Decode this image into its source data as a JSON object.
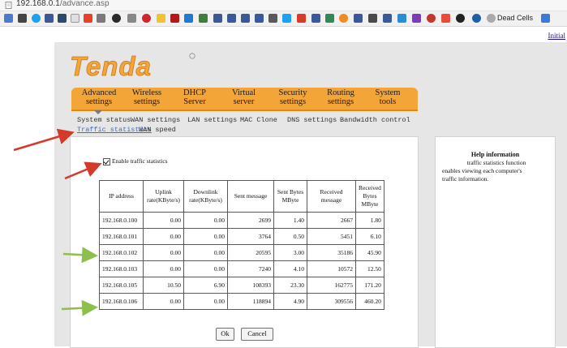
{
  "browser": {
    "url_host": "192.168.0.1",
    "url_path": "/advance.asp",
    "bookmarks": {
      "last_label": "Dead Cells"
    }
  },
  "initial_link": "Initial",
  "colors": {
    "nav_orange": "#f4a537",
    "logo_orange": "#f4a537",
    "arrow_red": "#d33a2c",
    "arrow_green": "#8dc04a",
    "active_link": "#3d6cc6"
  },
  "logo": {
    "text": "Tenda"
  },
  "main_nav": [
    {
      "line1": "Advanced",
      "line2": "settings"
    },
    {
      "line1": "Wireless",
      "line2": "settings"
    },
    {
      "line1": "DHCP",
      "line2": "Server"
    },
    {
      "line1": "Virtual",
      "line2": "server"
    },
    {
      "line1": "Security",
      "line2": "settings"
    },
    {
      "line1": "Routing",
      "line2": "settings"
    },
    {
      "line1": "System",
      "line2": "tools"
    }
  ],
  "sub_nav": [
    "System status",
    "WAN settings",
    "LAN settings",
    "MAC Clone",
    "DNS settings",
    "Bandwidth control",
    "Traffic statistics",
    "WAN speed"
  ],
  "enable_checkbox": {
    "label": "Enable traffic statistics",
    "checked": true
  },
  "table": {
    "headers": [
      "IP address",
      "Uplink rate(KByte/s)",
      "Downlink rate(KByte/s)",
      "Sent message",
      "Sent Bytes MByte",
      "Received message",
      "Received Bytes MByte"
    ],
    "rows": [
      [
        "192.168.0.100",
        "0.00",
        "0.00",
        "2699",
        "1.40",
        "2667",
        "1.80"
      ],
      [
        "192.168.0.101",
        "0.00",
        "0.00",
        "3764",
        "0.50",
        "5451",
        "6.10"
      ],
      [
        "192.168.0.102",
        "0.00",
        "0.00",
        "20595",
        "3.00",
        "35186",
        "45.90"
      ],
      [
        "192.168.0.103",
        "0.00",
        "0.00",
        "7240",
        "4.10",
        "10572",
        "12.50"
      ],
      [
        "192.168.0.105",
        "10.50",
        "6.90",
        "108393",
        "23.30",
        "162775",
        "171.20"
      ],
      [
        "192.168.0.106",
        "0.00",
        "0.00",
        "118894",
        "4.90",
        "309556",
        "460.20"
      ]
    ]
  },
  "buttons": {
    "ok": "Ok",
    "cancel": "Cancel"
  },
  "help": {
    "title": "Help information",
    "line1": "traffic statistics function",
    "line2": "enables viewing each computer's",
    "line3": "traffic information."
  }
}
